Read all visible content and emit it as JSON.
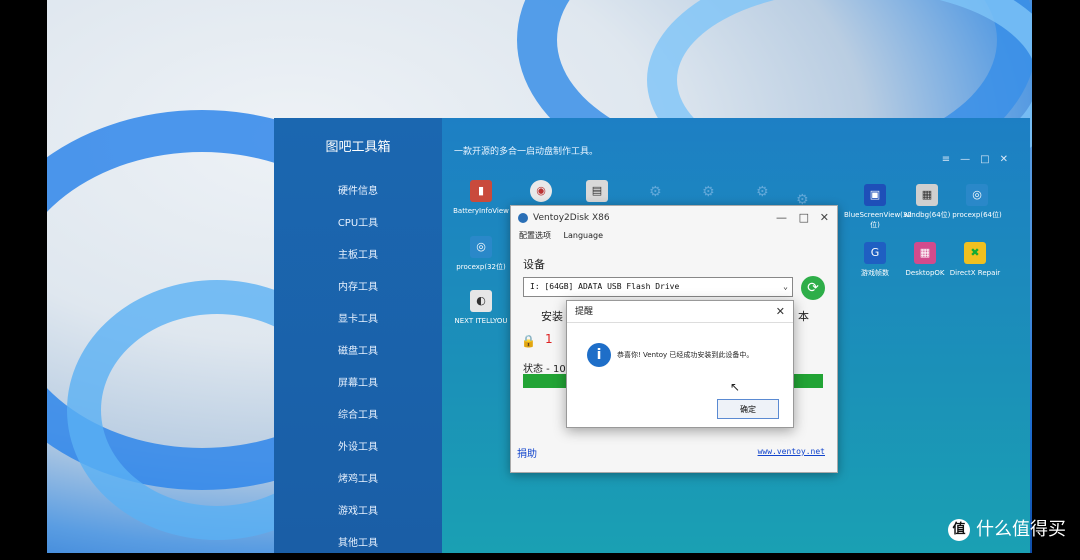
{
  "toolbox": {
    "title": "图吧工具箱",
    "subtitle": "一款开源的多合一启动盘制作工具。",
    "nav": [
      "硬件信息",
      "CPU工具",
      "主板工具",
      "内存工具",
      "显卡工具",
      "磁盘工具",
      "屏幕工具",
      "综合工具",
      "外设工具",
      "烤鸡工具",
      "游戏工具",
      "其他工具"
    ],
    "apps": [
      "BatteryInfoView",
      "procexp(32位)",
      "NEXT ITELLYOU",
      "BlueScreenView(32位)",
      "windbg(64位)",
      "procexp(64位)",
      "游戏帧数",
      "DesktopOK",
      "DirectX Repair"
    ]
  },
  "ventoy": {
    "title": "Ventoy2Disk X86",
    "menu": [
      "配置选项",
      "Language"
    ],
    "device_label": "设备",
    "device_value": "I: [64GB] ADATA USB Flash Drive",
    "install_label": "安装",
    "version_label": "本",
    "status": "状态 - 10",
    "progress": 1.0,
    "donate": "捐助",
    "website": "www.ventoy.net"
  },
  "dialog": {
    "title": "提醒",
    "message": "恭喜你! Ventoy 已经成功安装到此设备中。",
    "ok": "确定"
  },
  "watermark": "什么值得买"
}
